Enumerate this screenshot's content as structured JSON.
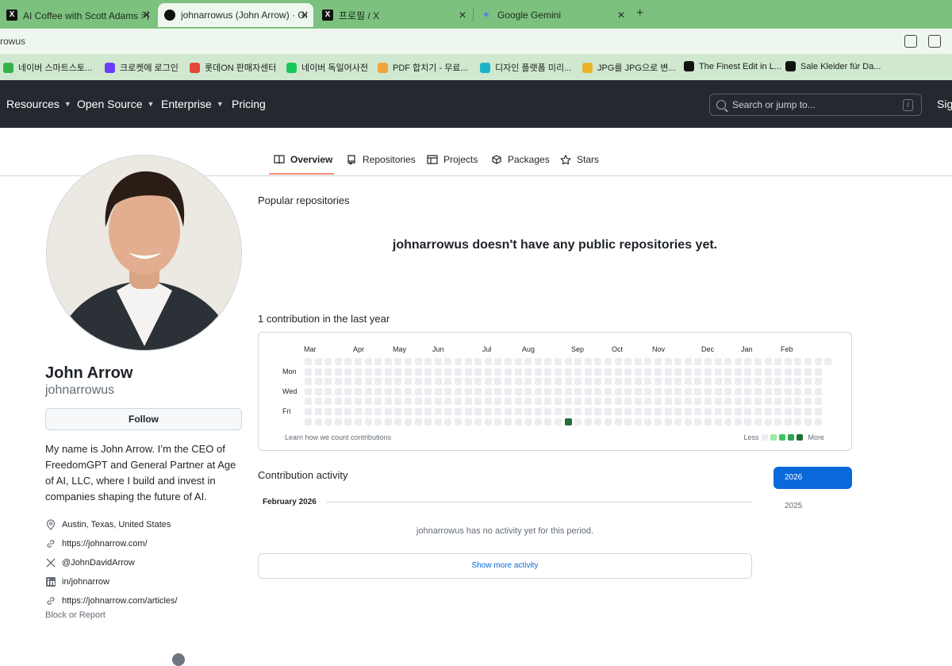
{
  "browser": {
    "tabs": [
      {
        "title": "AI Coffee with Scott Adams 키",
        "icon": "x-icon"
      },
      {
        "title": "johnarrowus (John Arrow) · Git",
        "icon": "github-icon",
        "active": true
      },
      {
        "title": "프로필 / X",
        "icon": "x-icon"
      },
      {
        "title": "Google Gemini",
        "icon": "gemini-icon"
      }
    ],
    "close_glyph": "✕",
    "new_tab_glyph": "+",
    "address": "rowus",
    "bookmarks": [
      {
        "label": "네이버 스마트스토...",
        "color": "#35b34a"
      },
      {
        "label": "크로켓에 로그인",
        "color": "#6d3df5"
      },
      {
        "label": "롯데ON 판매자센터",
        "color": "#e4473b"
      },
      {
        "label": "네이버 독일어사전",
        "color": "#19c85a"
      },
      {
        "label": "PDF 합치기 - 무료...",
        "color": "#f2a33a"
      },
      {
        "label": "디자인 플랫폼 미리...",
        "color": "#1ab4c9"
      },
      {
        "label": "JPG를 JPG으로 변...",
        "color": "#e9b429"
      },
      {
        "label": "The Finest Edit in L...",
        "color": "#111111"
      },
      {
        "label": "Sale Kleider für Da...",
        "color": "#111111"
      }
    ]
  },
  "header": {
    "nav": [
      {
        "label": "Resources",
        "has_caret": true
      },
      {
        "label": "Open Source",
        "has_caret": true
      },
      {
        "label": "Enterprise",
        "has_caret": true
      },
      {
        "label": "Pricing",
        "has_caret": false
      }
    ],
    "search_placeholder": "Search or jump to...",
    "search_shortcut": "/",
    "signin": "Sign"
  },
  "tabs": [
    {
      "label": "Overview",
      "icon": "book-icon",
      "active": true
    },
    {
      "label": "Repositories",
      "icon": "repo-icon"
    },
    {
      "label": "Projects",
      "icon": "table-icon"
    },
    {
      "label": "Packages",
      "icon": "package-icon"
    },
    {
      "label": "Stars",
      "icon": "star-icon"
    }
  ],
  "profile": {
    "name": "John Arrow",
    "username": "johnarrowus",
    "follow_label": "Follow",
    "bio": "My name is John Arrow. I’m the CEO of FreedomGPT and General Partner at Age of AI, LLC, where I build and invest in companies shaping the future of AI.",
    "location": "Austin, Texas, United States",
    "website": "https://johnarrow.com/",
    "twitter": "@JohnDavidArrow",
    "linkedin": "in/johnarrow",
    "articles": "https://johnarrow.com/articles/",
    "block_report": "Block or Report"
  },
  "main": {
    "popular_heading": "Popular repositories",
    "no_repos": "johnarrowus doesn't have any public repositories yet.",
    "contrib_heading": "1 contribution in the last year",
    "learn_link": "Learn how we count contributions",
    "legend_less": "Less",
    "legend_more": "More",
    "activity_heading": "Contribution activity",
    "activity_month": "February 2026",
    "no_activity": "johnarrowus has no activity yet for this period.",
    "show_more": "Show more activity",
    "years": [
      "2026",
      "2025"
    ]
  },
  "contrib_graph": {
    "months": [
      "Mar",
      "Apr",
      "May",
      "Jun",
      "Jul",
      "Aug",
      "Sep",
      "Oct",
      "Nov",
      "Dec",
      "Jan",
      "Feb"
    ],
    "day_labels": [
      "Mon",
      "Wed",
      "Fri"
    ],
    "weeks": 52,
    "last_week_days": 7,
    "extra_week_days": 1,
    "contribution_week": 26,
    "contribution_day": 6,
    "colors": {
      "empty": "#ebedf0",
      "l1": "#9be9a8",
      "l2": "#40c463",
      "l3": "#30a14e",
      "l4": "#216e39"
    }
  }
}
